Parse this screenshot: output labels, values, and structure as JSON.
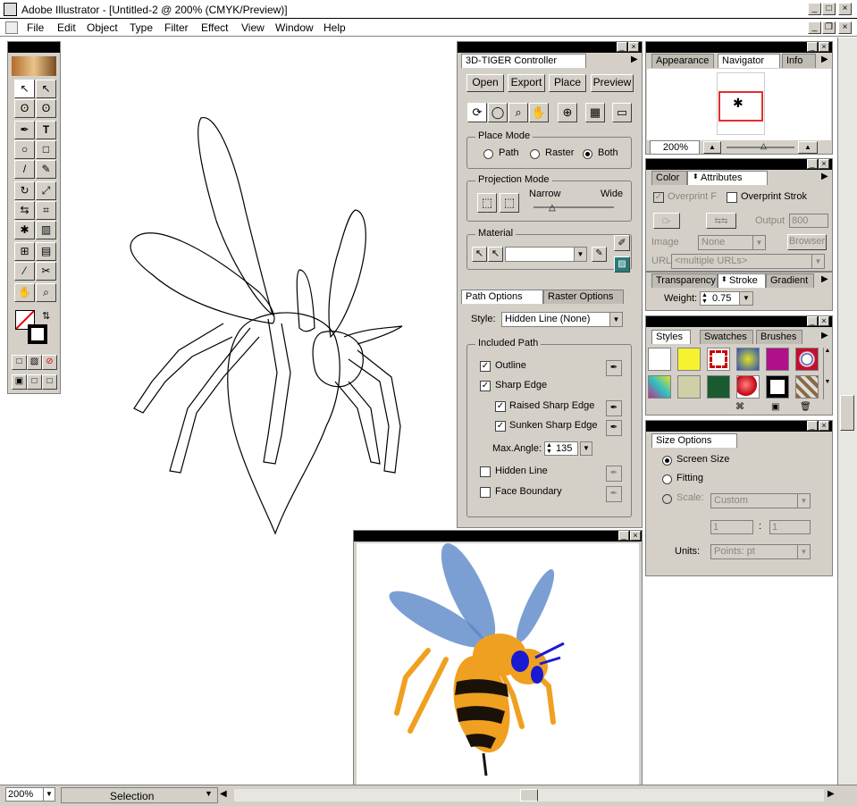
{
  "window": {
    "title": "Adobe Illustrator - [Untitled-2 @ 200% (CMYK/Preview)]"
  },
  "menu": [
    "File",
    "Edit",
    "Object",
    "Type",
    "Filter",
    "Effect",
    "View",
    "Window",
    "Help"
  ],
  "controller": {
    "title": "3D-TIGER Controller",
    "buttons": [
      "Open",
      "Export",
      "Place",
      "Preview"
    ],
    "place_mode": {
      "label": "Place Mode",
      "options": [
        "Path",
        "Raster",
        "Both"
      ],
      "selected": "Both"
    },
    "projection_mode": {
      "label": "Projection Mode",
      "narrow": "Narrow",
      "wide": "Wide"
    },
    "material": {
      "label": "Material"
    },
    "tabs": [
      "Path Options",
      "Raster Options"
    ],
    "style_label": "Style:",
    "style_value": "Hidden Line (None)",
    "included_path_label": "Included Path",
    "items": {
      "outline": "Outline",
      "sharp_edge": "Sharp Edge",
      "raised": "Raised Sharp Edge",
      "sunken": "Sunken Sharp Edge",
      "max_angle_label": "Max.Angle:",
      "max_angle_value": "135",
      "hidden_line": "Hidden Line",
      "face_boundary": "Face Boundary"
    }
  },
  "navigator": {
    "tabs": [
      "Appearance",
      "Navigator",
      "Info"
    ],
    "zoom": "200%"
  },
  "attributes": {
    "tabs": [
      "Color",
      "Attributes"
    ],
    "overprint_fill": "Overprint F",
    "overprint_stroke": "Overprint Strok",
    "output_label": "Output",
    "output_value": "800",
    "image_label": "Image",
    "image_value": "None",
    "browser": "Browser",
    "url_label": "URL",
    "url_value": "<multiple URLs>"
  },
  "stroke": {
    "tabs": [
      "Transparency",
      "Stroke",
      "Gradient"
    ],
    "weight_label": "Weight:",
    "weight_value": "0.75"
  },
  "styles": {
    "tabs": [
      "Styles",
      "Swatches",
      "Brushes"
    ]
  },
  "size_options": {
    "title": "Size Options",
    "options": [
      "Screen Size",
      "Fitting",
      "Scale:"
    ],
    "scale_value": "Custom",
    "w": "1",
    "h": "1",
    "sep": ":",
    "units_label": "Units:",
    "units_value": "Points: pt"
  },
  "status": {
    "zoom": "200%",
    "tool": "Selection"
  },
  "colors": {
    "palette_bg": "#d4d0c8",
    "wasp_yellow": "#f0a020",
    "wasp_wing": "#5a87c8",
    "wasp_eye": "#1a1ad0"
  }
}
